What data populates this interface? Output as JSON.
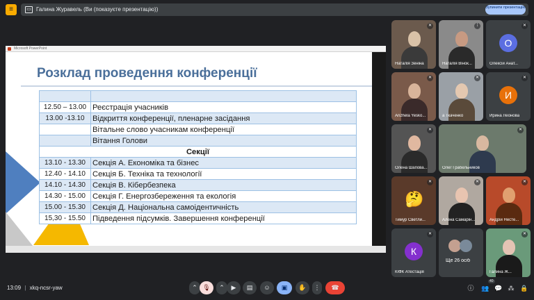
{
  "app": {
    "logo": "≡"
  },
  "banner": {
    "icon": "presentation-icon",
    "text": "Галина Журавель (Ви (показуєте презентацію))",
    "stop_label": "Зупинити презентацію"
  },
  "ppt": {
    "window_title": "Microsoft PowerPoint"
  },
  "slide": {
    "title": "Розклад проведення конференції",
    "rows": [
      {
        "time": "",
        "text": ""
      },
      {
        "time": "12.50 – 13.00",
        "text": "Реєстрація учасників"
      },
      {
        "time": "13.00 -13.10",
        "text": "Відкриття конференції, пленарне засідання"
      },
      {
        "time": "",
        "text": "Вітальне слово учасникам конференції"
      },
      {
        "time": "",
        "text": "Вітання Голови"
      },
      {
        "time": "",
        "text": "Секції",
        "header": true
      },
      {
        "time": "13.10 - 13.30",
        "text": "Секція А. Економіка та бізнес"
      },
      {
        "time": "12.40 - 14.10",
        "text": "Секція Б. Техніка та технології"
      },
      {
        "time": "14.10 - 14.30",
        "text": "Секція В. Кібербезпека"
      },
      {
        "time": "14.30 - 15.00",
        "text": "Секція Г. Енергозбереження та екологія"
      },
      {
        "time": "15.00 - 15.30",
        "text": "Секція Д. Національна самоідентичність"
      },
      {
        "time": "15,30 - 15.50",
        "text": "Підведення підсумків. Завершення конференції"
      }
    ]
  },
  "participants": [
    {
      "name": "Наталія Зеніна"
    },
    {
      "name": "Наталія Вінок..."
    },
    {
      "name": "Олексій Анат...",
      "initial": "О",
      "color": "#5b6ee1"
    },
    {
      "name": "Anzhela Yesko..."
    },
    {
      "name": "а Ткаченко"
    },
    {
      "name": "Ирина Леонова",
      "initial": "И",
      "color": "#e8710a"
    },
    {
      "name": "Олена Шапова..."
    },
    {
      "name": "Олег Грабельников"
    },
    {
      "name": "Тимур Светли...",
      "emoji": "🤔"
    },
    {
      "name": "Алена Самарін..."
    },
    {
      "name": "Андрій Несте..."
    },
    {
      "name": "КІФК Атестація",
      "initial": "К",
      "color": "#8430ce"
    },
    {
      "name": "Ще 26 осіб"
    },
    {
      "name": "Галина Ж..."
    }
  ],
  "bottom": {
    "time": "13:09",
    "separator": "|",
    "meeting_code": "xkq-ncsr-yaw",
    "people_count": "40"
  },
  "colors": {
    "background": "#202124",
    "end_call": "#ea4335",
    "present_active": "#8ab4f8",
    "mic_muted": "#f9dedc"
  }
}
